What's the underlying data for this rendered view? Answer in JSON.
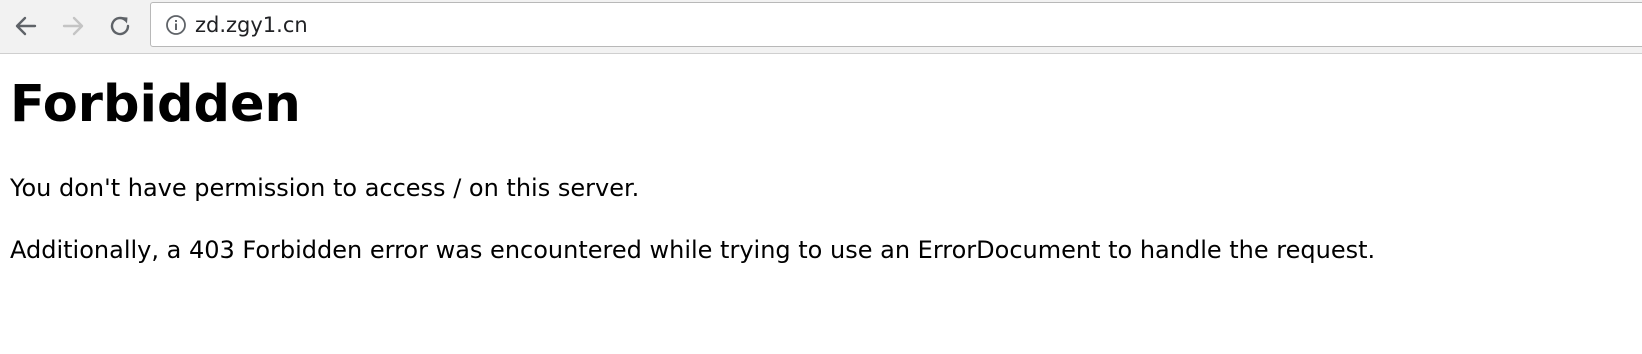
{
  "browser": {
    "address_bar": {
      "url": "zd.zgy1.cn",
      "security_icon": "info-icon"
    },
    "nav": {
      "back_icon": "arrow-left-icon",
      "forward_icon": "arrow-right-icon",
      "reload_icon": "reload-icon"
    }
  },
  "page": {
    "heading": "Forbidden",
    "paragraph_1": "You don't have permission to access / on this server.",
    "paragraph_2": "Additionally, a 403 Forbidden error was encountered while trying to use an ErrorDocument to handle the request."
  }
}
